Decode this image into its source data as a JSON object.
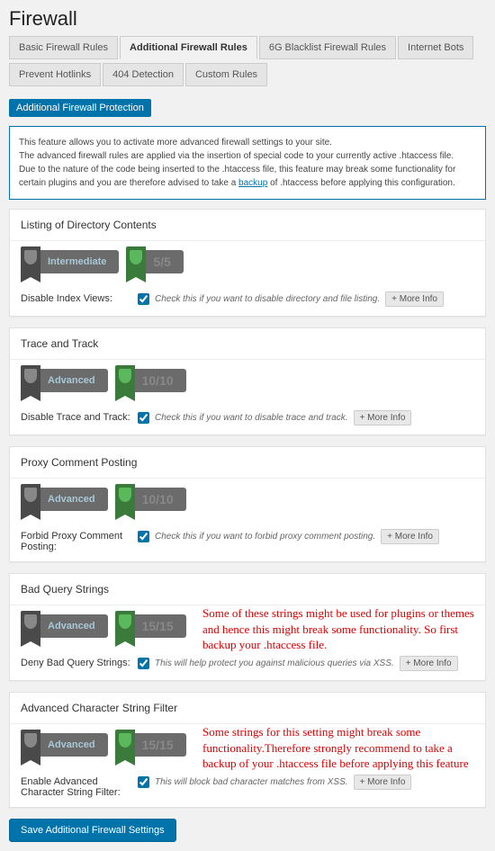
{
  "pageTitle": "Firewall",
  "tabs": [
    "Basic Firewall Rules",
    "Additional Firewall Rules",
    "6G Blacklist Firewall Rules",
    "Internet Bots",
    "Prevent Hotlinks",
    "404 Detection",
    "Custom Rules"
  ],
  "activeTab": 1,
  "sectionHeader": "Additional Firewall Protection",
  "infoBox": {
    "l1": "This feature allows you to activate more advanced firewall settings to your site.",
    "l2": "The advanced firewall rules are applied via the insertion of special code to your currently active .htaccess file.",
    "l3a": "Due to the nature of the code being inserted to the .htaccess file, this feature may break some functionality for certain plugins and you are therefore advised to take a ",
    "l3link": "backup",
    "l3b": " of .htaccess before applying this configuration."
  },
  "moreInfo": "+  More Info",
  "panels": [
    {
      "title": "Listing of Directory Contents",
      "level": "Intermediate",
      "score": "5/5",
      "label": "Disable Index Views:",
      "desc": "Check this if you want to disable directory and file listing."
    },
    {
      "title": "Trace and Track",
      "level": "Advanced",
      "score": "10/10",
      "label": "Disable Trace and Track:",
      "desc": "Check this if you want to disable trace and track."
    },
    {
      "title": "Proxy Comment Posting",
      "level": "Advanced",
      "score": "10/10",
      "label": "Forbid Proxy Comment Posting:",
      "desc": "Check this if you want to forbid proxy comment posting."
    },
    {
      "title": "Bad Query Strings",
      "level": "Advanced",
      "score": "15/15",
      "label": "Deny Bad Query Strings:",
      "desc": "This will help protect you against malicious queries via XSS.",
      "annotation": "Some of these strings might be used for plugins or themes and hence this might break some functionality.  So first backup your .htaccess file."
    },
    {
      "title": "Advanced Character String Filter",
      "level": "Advanced",
      "score": "15/15",
      "label": "Enable Advanced Character String Filter:",
      "desc": "This will block bad character matches from XSS.",
      "annotation": "Some strings for this setting might break some functionality.Therefore strongly recommend to take a backup of your .htaccess file before applying this feature"
    }
  ],
  "saveButton": "Save Additional Firewall Settings"
}
